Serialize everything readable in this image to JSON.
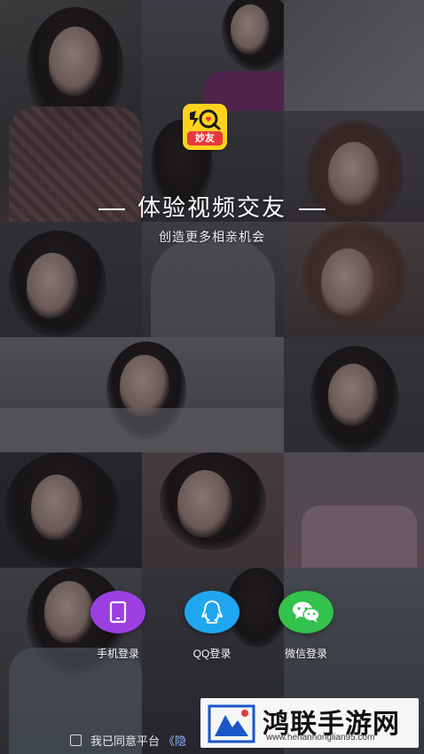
{
  "app": {
    "logo_badge": "妙友",
    "slogan": "体验视频交友",
    "subtitle": "创造更多相亲机会"
  },
  "login": [
    {
      "label": "手机登录",
      "color": "#9b3fe0",
      "icon": "phone-icon"
    },
    {
      "label": "QQ登录",
      "color": "#1fa6f0",
      "icon": "qq-penguin-icon"
    },
    {
      "label": "微信登录",
      "color": "#32c24d",
      "icon": "wechat-icon"
    }
  ],
  "agreement": {
    "prefix": "我已同意平台",
    "link": "《隐"
  },
  "watermark": {
    "title": "鸿联手游网",
    "url": "www.henanhonglian95.com"
  },
  "colors": {
    "logo_bg": "#ffd21e",
    "logo_badge_bg": "#e8383d",
    "watermark_blue": "#1a56c8"
  }
}
